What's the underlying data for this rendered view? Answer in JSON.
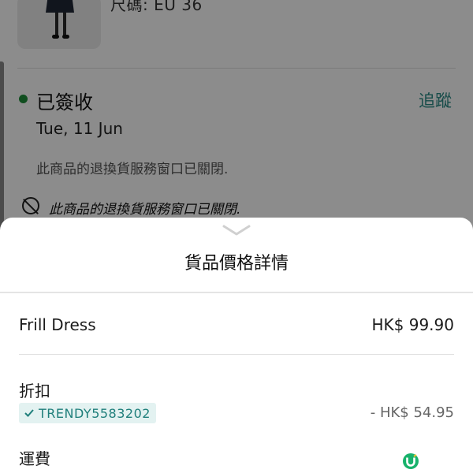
{
  "background": {
    "product_size": "尺碼: EU 36",
    "status": "已簽收",
    "track_link": "追蹤",
    "date": "Tue, 11 Jun",
    "return_window_note": "此商品的退換貨服務窗口已關閉.",
    "closed_notice": "此商品的退換貨服務窗口已關閉."
  },
  "sheet": {
    "title": "貨品價格詳情",
    "item": {
      "name": "Frill Dress",
      "price": "HK$ 99.90"
    },
    "discount": {
      "label": "折扣",
      "code": "TRENDY5583202",
      "amount": "- HK$ 54.95"
    },
    "shipping": {
      "label": "運費"
    }
  },
  "icons": {
    "status": "green-dot",
    "closed": "no-return-icon",
    "collapse": "chevron-down-icon",
    "promo": "check-icon",
    "badge": "app-badge-icon"
  },
  "colors": {
    "accent": "#2a8a86",
    "status_green": "#1e8f3a",
    "promo_bg": "#e3f2f1",
    "promo_text": "#1f7f7b",
    "overlay": "rgba(0,0,0,0.45)"
  }
}
